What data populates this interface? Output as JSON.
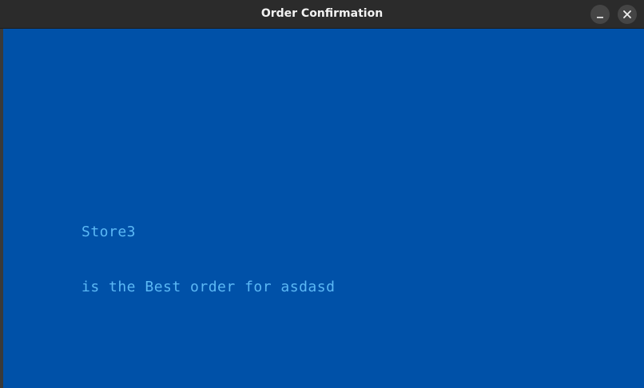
{
  "window": {
    "title": "Order Confirmation",
    "buttons": {
      "minimize_icon": "minimize-icon",
      "close_icon": "close-icon"
    }
  },
  "content": {
    "background_color": "#0051a8",
    "text_color": "#5bb8f5",
    "line1": "Store3",
    "line2": "is the Best order for asdasd"
  }
}
